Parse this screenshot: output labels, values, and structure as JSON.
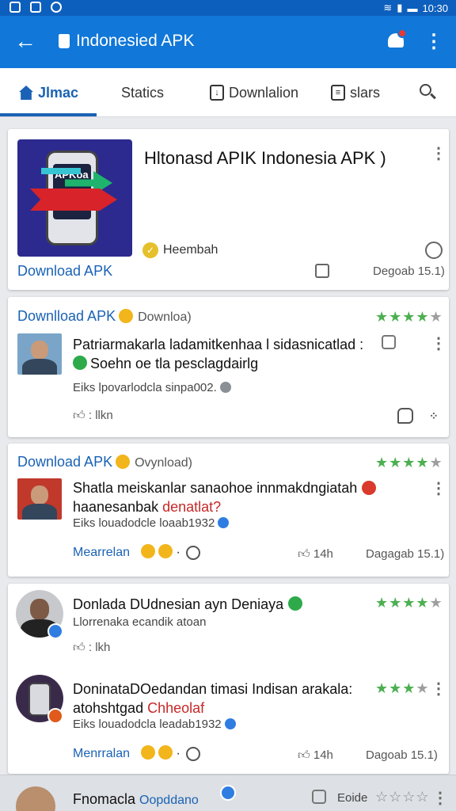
{
  "status_bar": {
    "time": "10:30"
  },
  "app_bar": {
    "title": "Indonesied APK"
  },
  "tabs": [
    {
      "label": "Jlmac"
    },
    {
      "label": "Statics"
    },
    {
      "label": "Downlalion"
    },
    {
      "label": "slars"
    }
  ],
  "featured": {
    "title": "Hltonasd APIK Indonesia APK )",
    "thumb_text": "APKoa",
    "developer": "Heembah",
    "download_label": "Download APK",
    "meta": "Degoab 15.1)"
  },
  "reviews": [
    {
      "header": "Downlload APK",
      "header_tag": "Downloa)",
      "rating": 4,
      "text_line1": "Patriarmakarla ladamitkenhaa l sidasnicatlad :",
      "text_line2": "Soehn oe tla pesclagdairlg",
      "sub": "Eiks lpovarlodcla sinpa002.",
      "like_label": ": llkn"
    },
    {
      "header": "Download APK",
      "header_tag": "Ovynload)",
      "rating": 4,
      "text_line1": "Shatla meiskanlar sanaohoe innmakdngiatah",
      "text_line2_plain": "haanesanbak ",
      "text_line2_red": "denatlat?",
      "sub": "Eiks louadodcle loaab1932",
      "action": "Mearrelan",
      "like_count": "14h",
      "meta": "Dagagab 15.1)"
    }
  ],
  "profiles": [
    {
      "name": "Donlada DUdnesian ayn Deniaya",
      "rating": 4,
      "sub": "Llorrenaka ecandik atoan",
      "like_label": ": lkh"
    },
    {
      "name": "DoninataDOedandan timasi Indisan arakala:",
      "line2_plain": "atohshtgad ",
      "line2_red": "Chheolaf",
      "rating": 3.5,
      "sub": "Eiks louadodcla leadab1932",
      "action": "Menrralan",
      "like_count": "14h",
      "meta": "Dagoab 15.1)"
    }
  ],
  "bottom": {
    "name": "Fnomacla",
    "tag": "Oopddano",
    "action": "Eoide"
  },
  "colors": {
    "appbar": "#1177d8",
    "status": "#0d5fbd",
    "accent": "#1a62b5",
    "stars": "#4caf50"
  }
}
